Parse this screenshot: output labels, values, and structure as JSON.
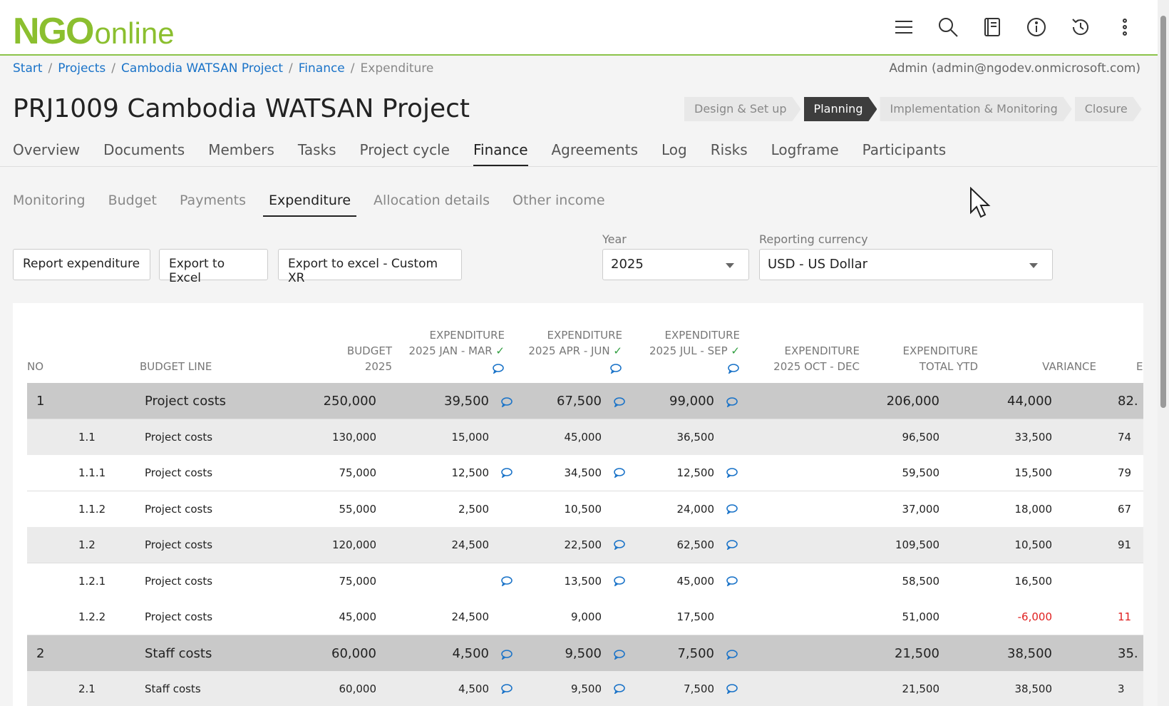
{
  "logo": {
    "big": "NGO",
    "small": "online"
  },
  "breadcrumb": [
    "Start",
    "Projects",
    "Cambodia WATSAN Project",
    "Finance",
    "Expenditure"
  ],
  "user": "Admin (admin@ngodev.onmicrosoft.com)",
  "project_title": "PRJ1009 Cambodia WATSAN Project",
  "stages": [
    "Design & Set up",
    "Planning",
    "Implementation & Monitoring",
    "Closure"
  ],
  "active_stage": "Planning",
  "tabs": [
    "Overview",
    "Documents",
    "Members",
    "Tasks",
    "Project cycle",
    "Finance",
    "Agreements",
    "Log",
    "Risks",
    "Logframe",
    "Participants"
  ],
  "active_tab": "Finance",
  "subtabs": [
    "Monitoring",
    "Budget",
    "Payments",
    "Expenditure",
    "Allocation details",
    "Other income"
  ],
  "active_subtab": "Expenditure",
  "buttons": {
    "report": "Report expenditure",
    "export": "Export to Excel",
    "export_custom": "Export to excel - Custom XR"
  },
  "filters": {
    "year_label": "Year",
    "year_value": "2025",
    "currency_label": "Reporting currency",
    "currency_value": "USD - US Dollar"
  },
  "icons": [
    "menu-icon",
    "search-icon",
    "book-icon",
    "info-icon",
    "history-icon",
    "more-vert-icon"
  ],
  "columns": {
    "no": "NO",
    "budget_line": "BUDGET LINE",
    "budget": [
      "BUDGET",
      "2025"
    ],
    "q1": [
      "EXPENDITURE",
      "2025 JAN - MAR"
    ],
    "q2": [
      "EXPENDITURE",
      "2025 APR - JUN"
    ],
    "q3": [
      "EXPENDITURE",
      "2025 JUL - SEP"
    ],
    "q4": [
      "EXPENDITURE",
      "2025 OCT - DEC"
    ],
    "total": [
      "EXPENDITURE",
      "TOTAL YTD"
    ],
    "variance": "VARIANCE",
    "last": "E"
  },
  "rows": [
    {
      "level": 0,
      "no": "1",
      "line": "Project costs",
      "budget": "250,000",
      "q1": "39,500",
      "q1c": true,
      "q2": "67,500",
      "q2c": true,
      "q3": "99,000",
      "q3c": true,
      "total": "206,000",
      "variance": "44,000",
      "last": "82."
    },
    {
      "level": 1,
      "no": "1.1",
      "line": "Project costs",
      "budget": "130,000",
      "q1": "15,000",
      "q1c": false,
      "q2": "45,000",
      "q2c": false,
      "q3": "36,500",
      "q3c": false,
      "total": "96,500",
      "variance": "33,500",
      "last": "74"
    },
    {
      "level": 2,
      "no": "1.1.1",
      "line": "Project costs",
      "budget": "75,000",
      "q1": "12,500",
      "q1c": true,
      "q2": "34,500",
      "q2c": true,
      "q3": "12,500",
      "q3c": true,
      "total": "59,500",
      "variance": "15,500",
      "last": "79"
    },
    {
      "level": 2,
      "no": "1.1.2",
      "line": "Project costs",
      "budget": "55,000",
      "q1": "2,500",
      "q1c": false,
      "q2": "10,500",
      "q2c": false,
      "q3": "24,000",
      "q3c": true,
      "total": "37,000",
      "variance": "18,000",
      "last": "67"
    },
    {
      "level": 1,
      "no": "1.2",
      "line": "Project costs",
      "budget": "120,000",
      "q1": "24,500",
      "q1c": false,
      "q2": "22,500",
      "q2c": true,
      "q3": "62,500",
      "q3c": true,
      "total": "109,500",
      "variance": "10,500",
      "last": "91"
    },
    {
      "level": 2,
      "no": "1.2.1",
      "line": "Project costs",
      "budget": "75,000",
      "q1": "",
      "q1c": true,
      "q2": "13,500",
      "q2c": true,
      "q3": "45,000",
      "q3c": true,
      "total": "58,500",
      "variance": "16,500",
      "last": ""
    },
    {
      "level": 2,
      "no": "1.2.2",
      "line": "Project costs",
      "budget": "45,000",
      "q1": "24,500",
      "q1c": false,
      "q2": "9,000",
      "q2c": false,
      "q3": "17,500",
      "q3c": false,
      "total": "51,000",
      "variance": "-6,000",
      "last": "11"
    },
    {
      "level": 0,
      "no": "2",
      "line": "Staff costs",
      "budget": "60,000",
      "q1": "4,500",
      "q1c": true,
      "q2": "9,500",
      "q2c": true,
      "q3": "7,500",
      "q3c": true,
      "total": "21,500",
      "variance": "38,500",
      "last": "35."
    },
    {
      "level": 1,
      "no": "2.1",
      "line": "Staff costs",
      "budget": "60,000",
      "q1": "4,500",
      "q1c": true,
      "q2": "9,500",
      "q2c": true,
      "q3": "7,500",
      "q3c": true,
      "total": "21,500",
      "variance": "38,500",
      "last": "3"
    }
  ]
}
